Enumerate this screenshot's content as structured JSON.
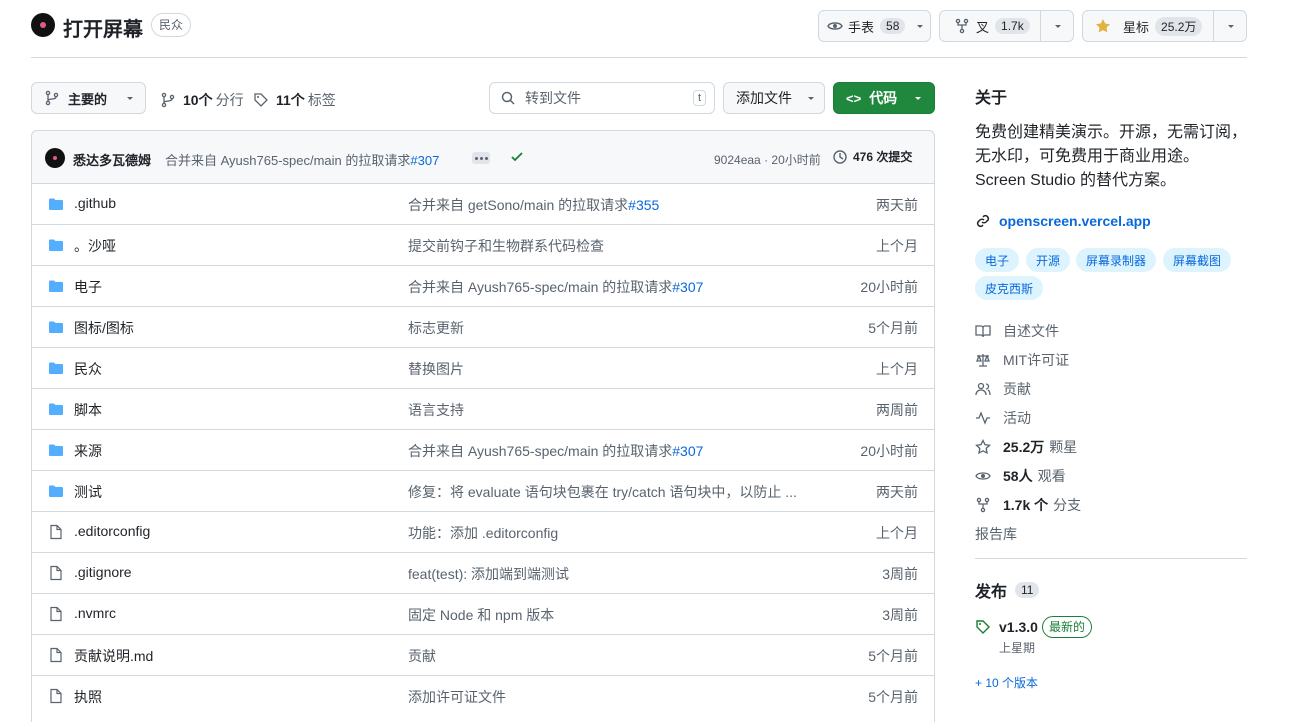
{
  "repo": {
    "name": "打开屏幕",
    "visibility": "民众"
  },
  "actions": {
    "watch_label": "手表",
    "watch_count": "58",
    "fork_label": "叉",
    "fork_count": "1.7k",
    "star_label": "星标",
    "star_count": "25.2万"
  },
  "toolbar": {
    "branch": "主要的",
    "branches_count": "10个",
    "branches_label": "分行",
    "tags_count": "11个",
    "tags_label": "标签",
    "search_placeholder": "转到文件",
    "search_key": "t",
    "add_file": "添加文件",
    "code": "代码"
  },
  "commit": {
    "author": "悉达多瓦德姆",
    "message": "合并来自 Ayush765-spec/main 的拉取请求",
    "pr": "#307",
    "hash": "9024eaa",
    "dot": "·",
    "time": "20小时前",
    "count": "476 次提交"
  },
  "files": [
    {
      "name": ".github",
      "type": "dir",
      "msg": "合并来自 getSono/main 的拉取请求",
      "pr": "#355",
      "time": "两天前"
    },
    {
      "name": "。沙哑",
      "type": "dir",
      "msg": "提交前钩子和生物群系代码检查",
      "pr": "",
      "time": "上个月"
    },
    {
      "name": "电子",
      "type": "dir",
      "msg": "合并来自 Ayush765-spec/main 的拉取请求",
      "pr": "#307",
      "time": "20小时前"
    },
    {
      "name": "图标/图标",
      "type": "dir",
      "msg": "标志更新",
      "pr": "",
      "time": "5个月前"
    },
    {
      "name": "民众",
      "type": "dir",
      "msg": "替换图片",
      "pr": "",
      "time": "上个月"
    },
    {
      "name": "脚本",
      "type": "dir",
      "msg": "语言支持",
      "pr": "",
      "time": "两周前"
    },
    {
      "name": "来源",
      "type": "dir",
      "msg": "合并来自 Ayush765-spec/main 的拉取请求",
      "pr": "#307",
      "time": "20小时前"
    },
    {
      "name": "测试",
      "type": "dir",
      "msg": "修复：将 evaluate 语句块包裹在 try/catch 语句块中，以防止 ...",
      "pr": "",
      "time": "两天前"
    },
    {
      "name": ".editorconfig",
      "type": "file",
      "msg": "功能：添加 .editorconfig",
      "pr": "",
      "time": "上个月"
    },
    {
      "name": ".gitignore",
      "type": "file",
      "msg": "feat(test): 添加端到端测试",
      "pr": "",
      "time": "3周前"
    },
    {
      "name": ".nvmrc",
      "type": "file",
      "msg": "固定 Node 和 npm 版本",
      "pr": "",
      "time": "3周前"
    },
    {
      "name": "贡献说明.md",
      "type": "file",
      "msg": "贡献",
      "pr": "",
      "time": "5个月前"
    },
    {
      "name": "执照",
      "type": "file",
      "msg": "添加许可证文件",
      "pr": "",
      "time": "5个月前"
    }
  ],
  "about": {
    "heading": "关于",
    "description": "免费创建精美演示。开源，无需订阅，无水印，可免费用于商业用途。Screen Studio 的替代方案。",
    "link": "openscreen.vercel.app",
    "topics": [
      "电子",
      "开源",
      "屏幕录制器",
      "屏幕截图",
      "皮克西斯"
    ],
    "items": [
      {
        "icon": "book-icon",
        "label": "自述文件"
      },
      {
        "icon": "law-icon",
        "label": "MIT许可证"
      },
      {
        "icon": "people-icon",
        "label": "贡献"
      },
      {
        "icon": "pulse-icon",
        "label": "活动"
      }
    ],
    "stars_value": "25.2万",
    "stars_label": "颗星",
    "watch_value": "58人",
    "watch_label": "观看",
    "forks_value": "1.7k 个",
    "forks_label": "分支",
    "report": "报告库"
  },
  "releases": {
    "heading": "发布",
    "count": "11",
    "version": "v1.3.0",
    "latest": "最新的",
    "date": "上星期",
    "more": "+ 10 个版本"
  },
  "colors": {
    "accent": "#0969da",
    "green": "#1f883d",
    "folder": "#54aeff",
    "muted": "#59636e"
  }
}
